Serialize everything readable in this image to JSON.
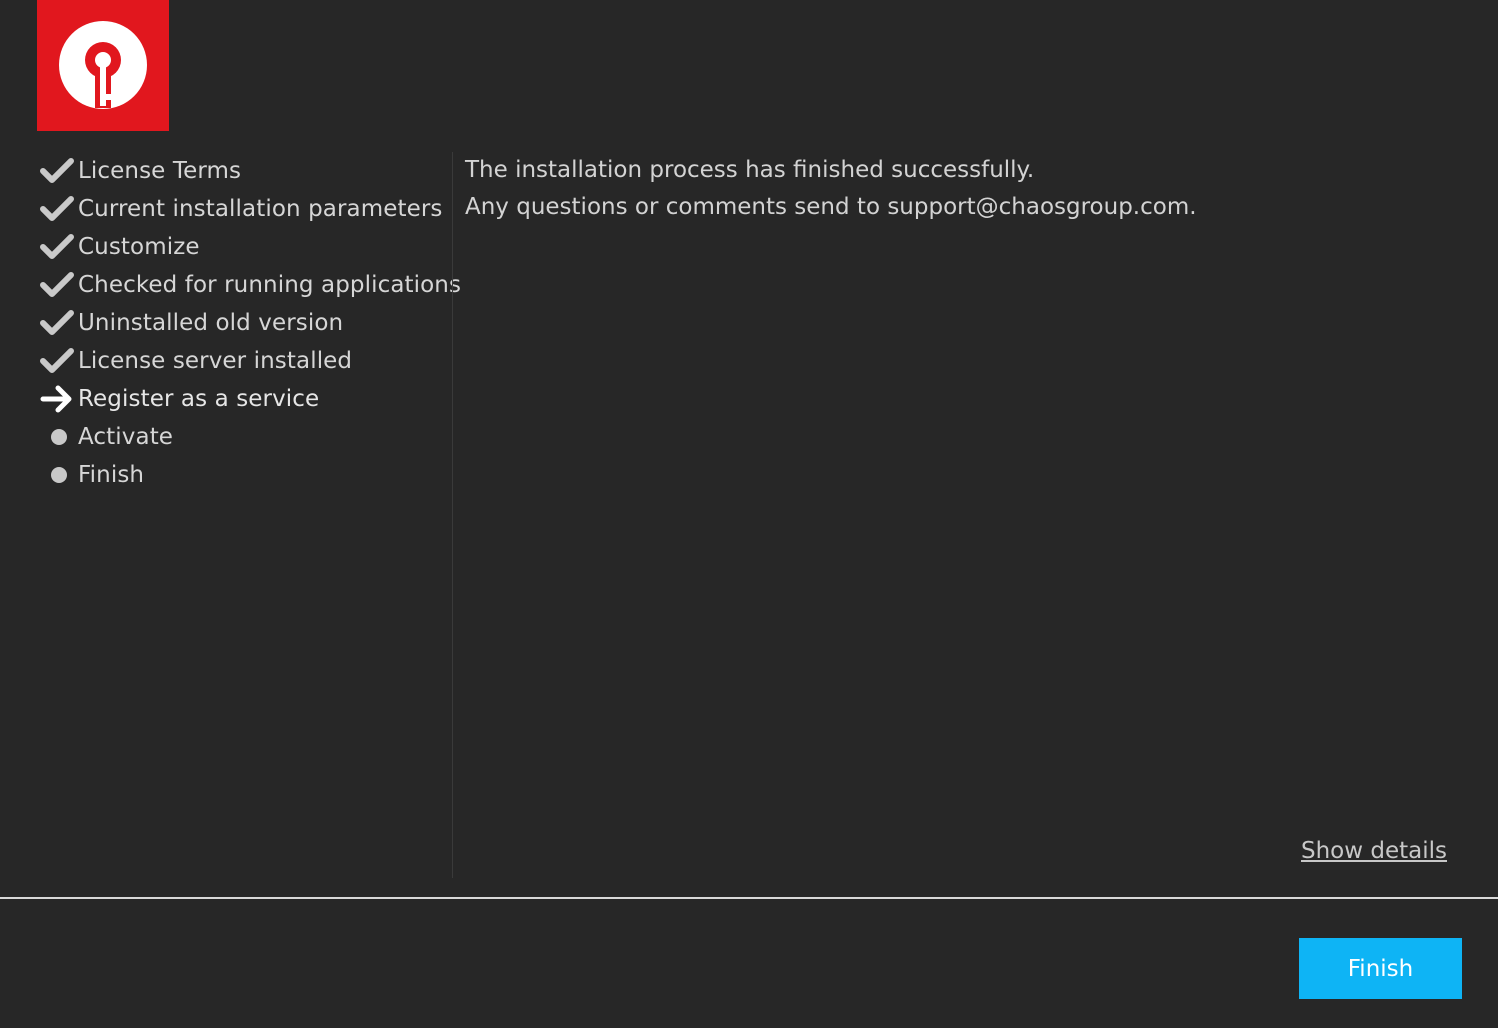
{
  "colors": {
    "background": "#272727",
    "logo_background": "#e1171e",
    "accent_button": "#0eb4f5",
    "text": "#d6d6d6"
  },
  "logo": {
    "icon": "keyhole-logo-icon"
  },
  "steps": [
    {
      "label": "License Terms",
      "status": "done",
      "icon": "check-icon"
    },
    {
      "label": "Current installation parameters",
      "status": "done",
      "icon": "check-icon"
    },
    {
      "label": "Customize",
      "status": "done",
      "icon": "check-icon"
    },
    {
      "label": "Checked for running applications",
      "status": "done",
      "icon": "check-icon"
    },
    {
      "label": "Uninstalled old version",
      "status": "done",
      "icon": "check-icon"
    },
    {
      "label": "License server installed",
      "status": "done",
      "icon": "check-icon"
    },
    {
      "label": "Register as a service",
      "status": "current",
      "icon": "arrow-right-icon"
    },
    {
      "label": "Activate",
      "status": "pending",
      "icon": "bullet-icon"
    },
    {
      "label": "Finish",
      "status": "pending",
      "icon": "bullet-icon"
    }
  ],
  "message": {
    "line1": "The installation process has finished successfully.",
    "line2": "Any questions or comments send to support@chaosgroup.com."
  },
  "show_details_label": "Show details",
  "finish_button_label": "Finish"
}
